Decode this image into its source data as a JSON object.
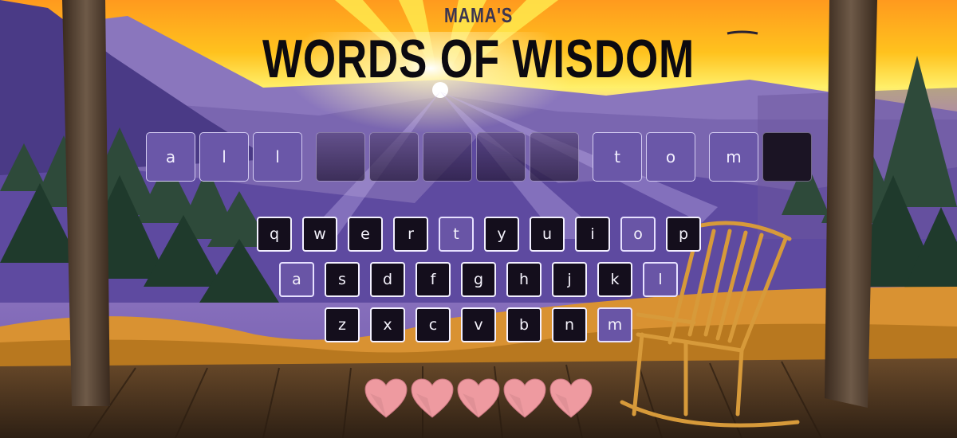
{
  "header": {
    "subtitle": "MAMA'S",
    "title": "WORDS OF WISDOM"
  },
  "puzzle": {
    "words": [
      [
        {
          "letter": "a",
          "state": "filled"
        },
        {
          "letter": "l",
          "state": "filled"
        },
        {
          "letter": "l",
          "state": "filled"
        }
      ],
      [
        {
          "letter": "",
          "state": "empty"
        },
        {
          "letter": "",
          "state": "empty"
        },
        {
          "letter": "",
          "state": "empty"
        },
        {
          "letter": "",
          "state": "empty"
        },
        {
          "letter": "",
          "state": "empty"
        }
      ],
      [
        {
          "letter": "t",
          "state": "filled"
        },
        {
          "letter": "o",
          "state": "filled"
        }
      ],
      [
        {
          "letter": "m",
          "state": "filled"
        },
        {
          "letter": "",
          "state": "dark"
        }
      ]
    ]
  },
  "keyboard": {
    "rows": [
      [
        "q",
        "w",
        "e",
        "r",
        "t",
        "y",
        "u",
        "i",
        "o",
        "p"
      ],
      [
        "a",
        "s",
        "d",
        "f",
        "g",
        "h",
        "j",
        "k",
        "l"
      ],
      [
        "z",
        "x",
        "c",
        "v",
        "b",
        "n",
        "m"
      ]
    ],
    "used_letters": [
      "t",
      "o",
      "a",
      "l",
      "m"
    ]
  },
  "lives": {
    "remaining": 5,
    "heart_icon": "heart-icon",
    "color": "#ee9aa0"
  },
  "colors": {
    "tile_filled": "#6a57a8",
    "key_default": "#140e1c",
    "key_used": "#6955a6",
    "title": "#0c0a10",
    "subtitle": "#3b3550"
  }
}
